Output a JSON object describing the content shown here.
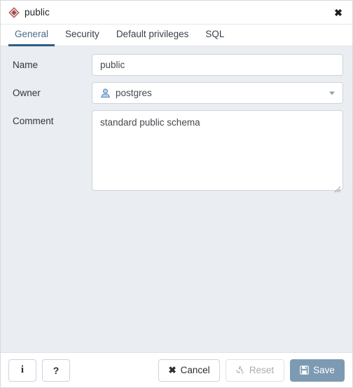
{
  "dialog": {
    "title": "public",
    "title_icon": "schema-diamond-icon",
    "close_label": "✖"
  },
  "tabs": [
    {
      "label": "General",
      "active": true
    },
    {
      "label": "Security",
      "active": false
    },
    {
      "label": "Default privileges",
      "active": false
    },
    {
      "label": "SQL",
      "active": false
    }
  ],
  "form": {
    "name": {
      "label": "Name",
      "value": "public",
      "placeholder": ""
    },
    "owner": {
      "label": "Owner",
      "value": "postgres",
      "icon": "user-icon",
      "caret": "chevron-down-icon"
    },
    "comment": {
      "label": "Comment",
      "value": "standard public schema",
      "placeholder": ""
    }
  },
  "footer": {
    "info_label": "i",
    "help_label": "?",
    "cancel_label": "Cancel",
    "reset_label": "Reset",
    "save_label": "Save"
  },
  "colors": {
    "body_background": "#eaedf1",
    "panel_background": "#ffffff",
    "accent_tab": "#2f5d85",
    "active_tab_text": "#4a6b8a",
    "save_button": "#7d9ab3",
    "schema_icon": "#b05a5a",
    "owner_icon": "#5b8bc0",
    "input_border": "#ced4da",
    "disabled_text": "#a9adb2"
  }
}
